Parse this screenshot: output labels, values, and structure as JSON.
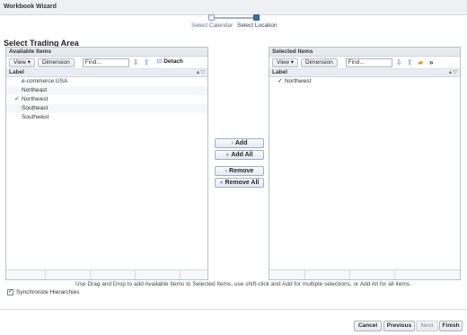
{
  "window": {
    "title": "Workbook Wizard"
  },
  "train": {
    "step1": "Select Calendar",
    "step2": "Select Location"
  },
  "page_title": "Select Trading Area",
  "available": {
    "header": "Available Items",
    "view": "View ▾",
    "dimension": "Dimension",
    "find_value": "Find...",
    "detach": "Detach",
    "column": "Label",
    "items": [
      {
        "label": "e-commerce USA",
        "checked": false
      },
      {
        "label": "Northeast",
        "checked": false
      },
      {
        "label": "Northwest",
        "checked": true
      },
      {
        "label": "Southeast",
        "checked": false
      },
      {
        "label": "Southwest",
        "checked": false
      }
    ]
  },
  "selected": {
    "header": "Selected Items",
    "view": "View ▾",
    "dimension": "Dimension",
    "find_value": "Find...",
    "column": "Label",
    "items": [
      {
        "label": "Northwest",
        "checked": true
      }
    ]
  },
  "actions": {
    "add": "Add",
    "add_all": "Add All",
    "remove": "Remove",
    "remove_all": "Remove All"
  },
  "hint": "Use Drag and Drop to add Available Items to Selected Items, use shift-click and Add for multiple selections, or Add All for all items.",
  "sync_label": "Synchronize Hierarchies",
  "footer": {
    "cancel": "Cancel",
    "previous": "Previous",
    "next": "Next",
    "finish": "Finish"
  },
  "icons": {
    "check": "✓",
    "down_arrow": "⇩",
    "up_arrow": "⇧",
    "detach": "⊡",
    "add": "›",
    "add_all": "»",
    "remove": "‹",
    "remove_all": "«",
    "sort": "▲▽",
    "more": "»"
  }
}
